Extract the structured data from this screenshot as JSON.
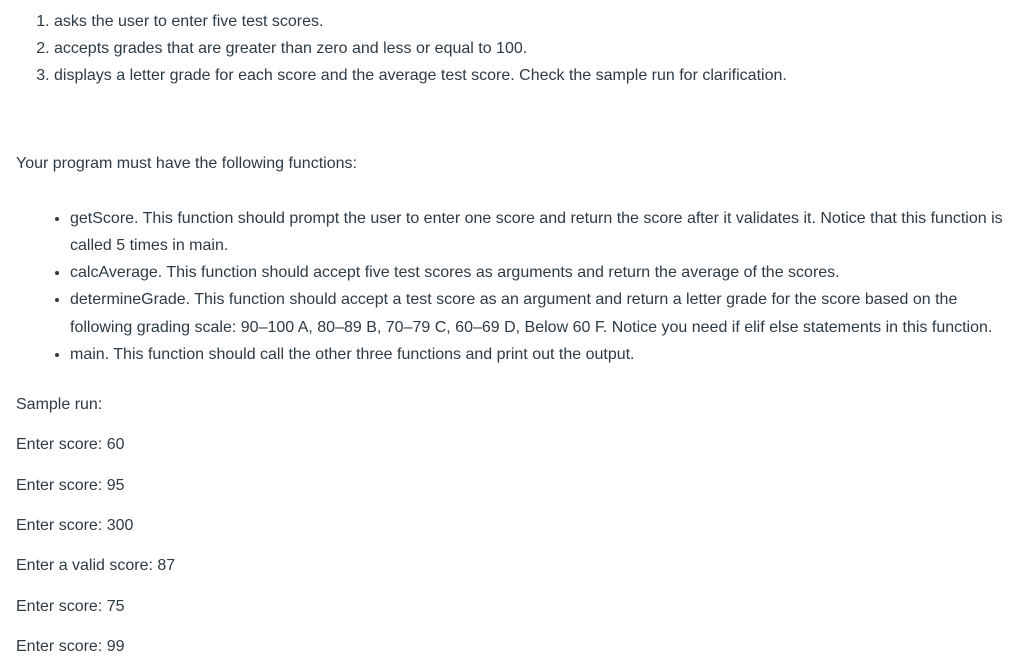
{
  "requirements": [
    "asks the user to enter five test scores.",
    "accepts grades that are greater than zero and less or equal to 100.",
    "displays a letter grade for each score and the average test score. Check the sample run for clarification."
  ],
  "intro": "Your program must have the following functions:",
  "functions": [
    "getScore. This function should prompt the user to enter one score and return the score after it validates it. Notice that this function is called 5 times in main.",
    "calcAverage. This function should accept five test scores as arguments and return the average of the scores.",
    "determineGrade. This function should accept a test score as an argument and return a letter grade for the score based on the following grading scale: 90–100 A, 80–89 B,  70–79 C, 60–69 D,  Below 60 F. Notice you need if elif else statements in this function.",
    "main. This function should call the other three functions and print out the output."
  ],
  "sample_label": "Sample run:",
  "sample_lines": [
    "Enter score: 60",
    "Enter score: 95",
    "Enter score: 300",
    "Enter a valid score: 87",
    "Enter score: 75",
    "Enter score: 99"
  ]
}
